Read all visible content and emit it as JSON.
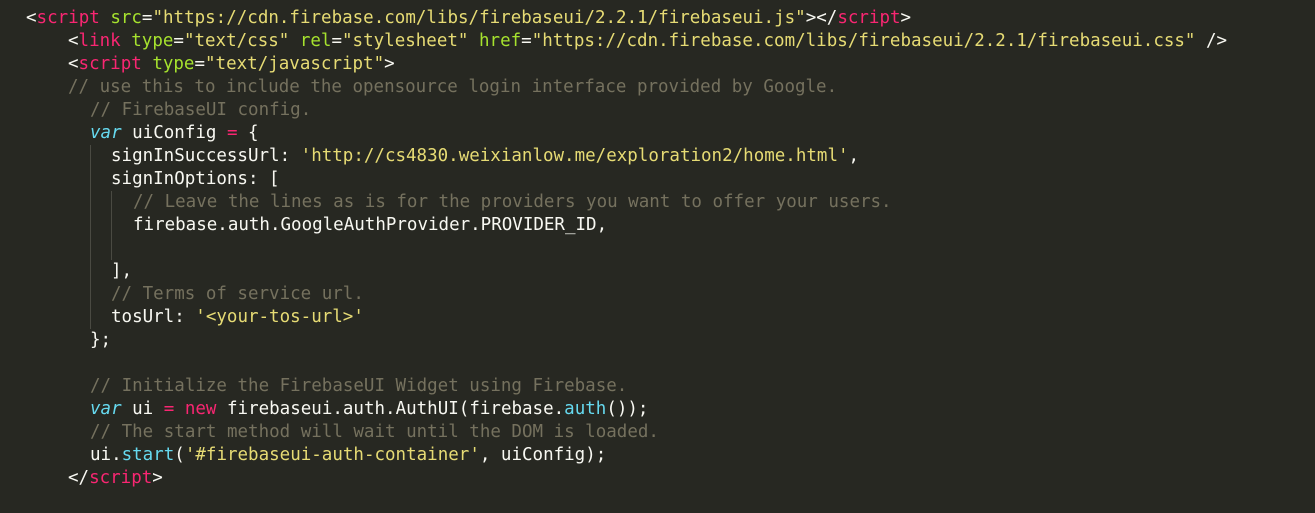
{
  "editor": {
    "theme_colors": {
      "background": "#272822",
      "tag": "#f92672",
      "attribute": "#a6e22e",
      "string": "#e6db74",
      "comment": "#75715e",
      "keyword": "#66d9ef",
      "text": "#f8f8f2"
    },
    "lines": [
      [
        {
          "t": "<",
          "c": "plain"
        },
        {
          "t": "script",
          "c": "tag"
        },
        {
          "t": " ",
          "c": "plain"
        },
        {
          "t": "src",
          "c": "attr"
        },
        {
          "t": "=",
          "c": "plain"
        },
        {
          "t": "\"https://cdn.firebase.com/libs/firebaseui/2.2.1/firebaseui.js\"",
          "c": "str"
        },
        {
          "t": "></",
          "c": "plain"
        },
        {
          "t": "script",
          "c": "tag"
        },
        {
          "t": ">",
          "c": "plain"
        }
      ],
      [
        {
          "t": "<",
          "c": "plain"
        },
        {
          "t": "link",
          "c": "tag"
        },
        {
          "t": " ",
          "c": "plain"
        },
        {
          "t": "type",
          "c": "attr"
        },
        {
          "t": "=",
          "c": "plain"
        },
        {
          "t": "\"text/css\"",
          "c": "str"
        },
        {
          "t": " ",
          "c": "plain"
        },
        {
          "t": "rel",
          "c": "attr"
        },
        {
          "t": "=",
          "c": "plain"
        },
        {
          "t": "\"stylesheet\"",
          "c": "str"
        },
        {
          "t": " ",
          "c": "plain"
        },
        {
          "t": "href",
          "c": "attr"
        },
        {
          "t": "=",
          "c": "plain"
        },
        {
          "t": "\"https://cdn.firebase.com/libs/firebaseui/2.2.1/firebaseui.css\"",
          "c": "str"
        },
        {
          "t": " />",
          "c": "plain"
        }
      ],
      [
        {
          "t": "<",
          "c": "plain"
        },
        {
          "t": "script",
          "c": "tag"
        },
        {
          "t": " ",
          "c": "plain"
        },
        {
          "t": "type",
          "c": "attr"
        },
        {
          "t": "=",
          "c": "plain"
        },
        {
          "t": "\"text/javascript\"",
          "c": "str"
        },
        {
          "t": ">",
          "c": "plain"
        }
      ],
      [
        {
          "t": "// use this to include the opensource login interface provided by Google.",
          "c": "cmt"
        }
      ],
      [
        {
          "t": "// FirebaseUI config.",
          "c": "cmt"
        }
      ],
      [
        {
          "t": "var",
          "c": "kw"
        },
        {
          "t": " uiConfig ",
          "c": "plain"
        },
        {
          "t": "=",
          "c": "op"
        },
        {
          "t": " {",
          "c": "plain"
        }
      ],
      [
        {
          "t": "signInSuccessUrl: ",
          "c": "plain"
        },
        {
          "t": "'http://cs4830.weixianlow.me/exploration2/home.html'",
          "c": "str"
        },
        {
          "t": ",",
          "c": "plain"
        }
      ],
      [
        {
          "t": "signInOptions: [",
          "c": "plain"
        }
      ],
      [
        {
          "t": "// Leave the lines as is for the providers you want to offer your users.",
          "c": "cmt"
        }
      ],
      [
        {
          "t": "firebase.auth.GoogleAuthProvider.PROVIDER_ID,",
          "c": "plain"
        }
      ],
      [],
      [
        {
          "t": "],",
          "c": "plain"
        }
      ],
      [
        {
          "t": "// Terms of service url.",
          "c": "cmt"
        }
      ],
      [
        {
          "t": "tosUrl: ",
          "c": "plain"
        },
        {
          "t": "'<your-tos-url>'",
          "c": "str"
        }
      ],
      [
        {
          "t": "};",
          "c": "plain"
        }
      ],
      [],
      [
        {
          "t": "// Initialize the FirebaseUI Widget using Firebase.",
          "c": "cmt"
        }
      ],
      [
        {
          "t": "var",
          "c": "kw"
        },
        {
          "t": " ui ",
          "c": "plain"
        },
        {
          "t": "=",
          "c": "op"
        },
        {
          "t": " ",
          "c": "plain"
        },
        {
          "t": "new",
          "c": "op"
        },
        {
          "t": " firebaseui.auth.AuthUI(firebase.",
          "c": "plain"
        },
        {
          "t": "auth",
          "c": "fn"
        },
        {
          "t": "());",
          "c": "plain"
        }
      ],
      [
        {
          "t": "// The start method will wait until the DOM is loaded.",
          "c": "cmt"
        }
      ],
      [
        {
          "t": "ui.",
          "c": "plain"
        },
        {
          "t": "start",
          "c": "fn"
        },
        {
          "t": "(",
          "c": "plain"
        },
        {
          "t": "'#firebaseui-auth-container'",
          "c": "str"
        },
        {
          "t": ", uiConfig);",
          "c": "plain"
        }
      ],
      [
        {
          "t": "</",
          "c": "plain"
        },
        {
          "t": "script",
          "c": "tag"
        },
        {
          "t": ">",
          "c": "plain"
        }
      ]
    ]
  }
}
